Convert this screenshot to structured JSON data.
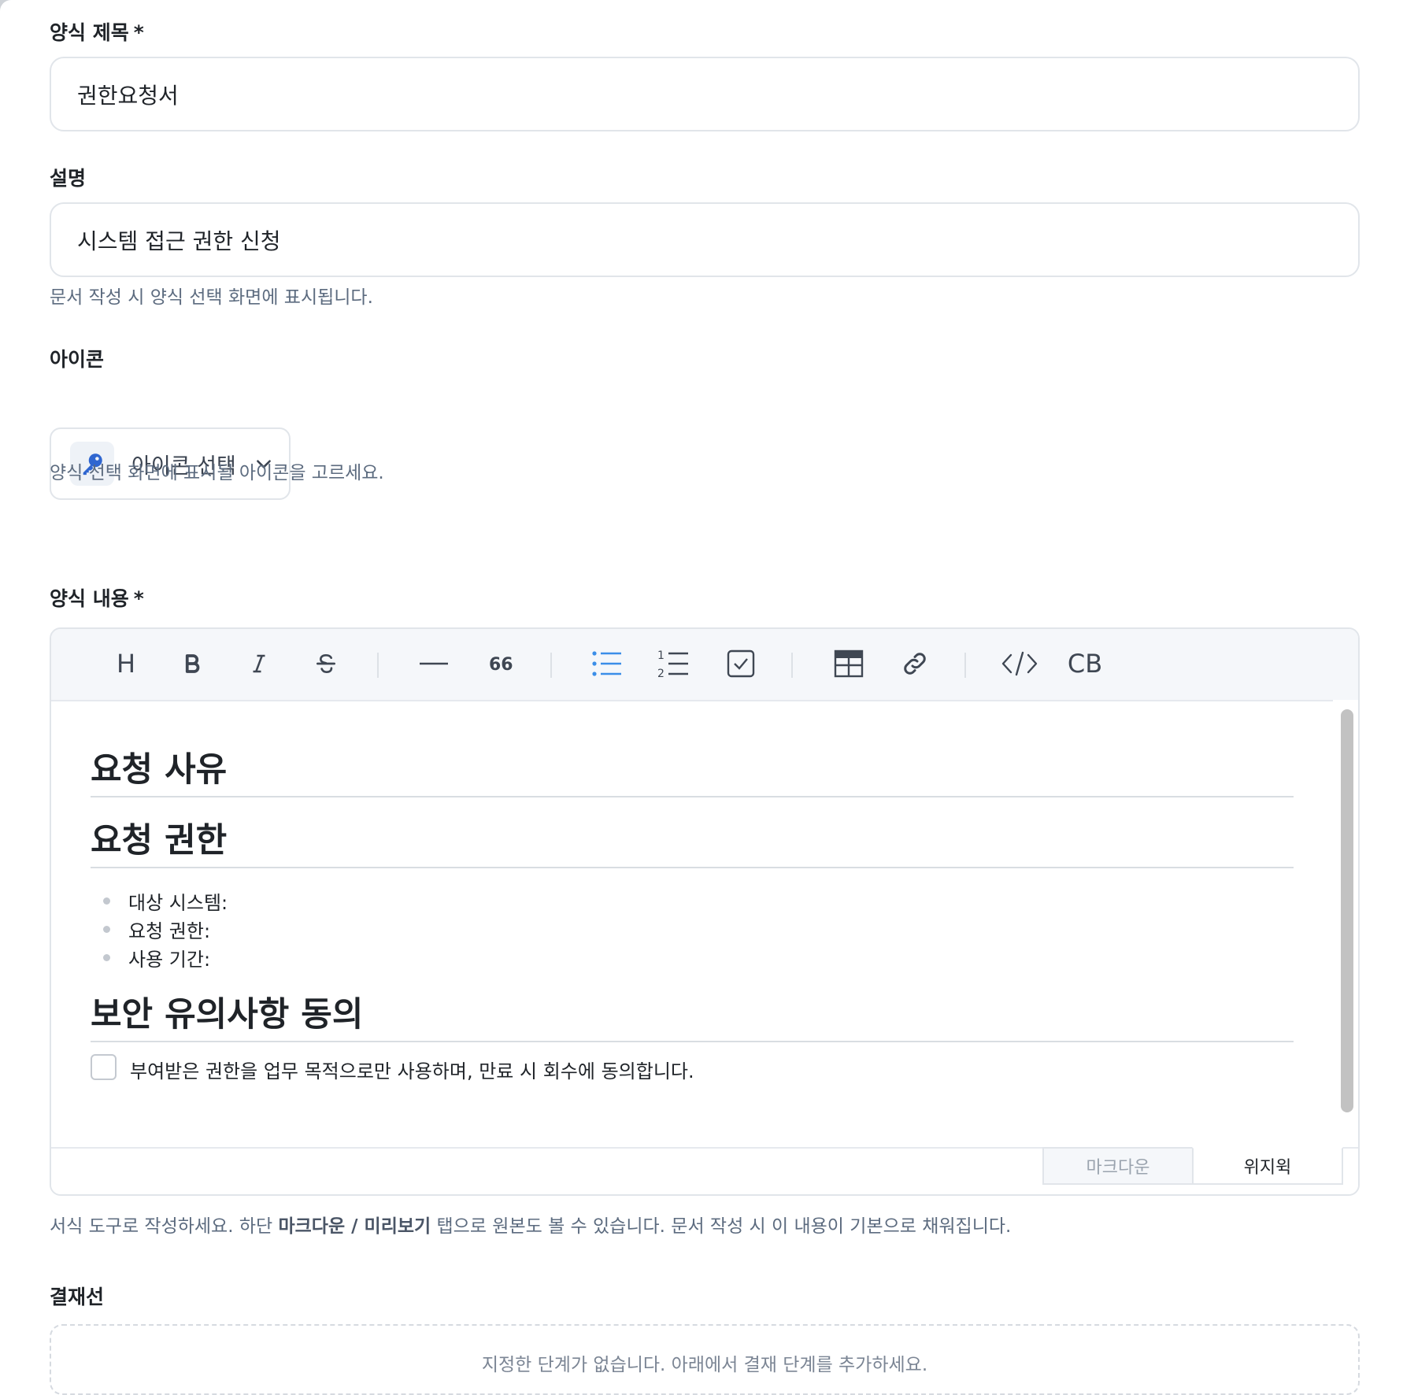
{
  "form": {
    "title_label": "양식 제목",
    "required_mark": "*",
    "title_value": "권한요청서",
    "description_label": "설명",
    "description_value": "시스템 접근 권한 신청",
    "description_help": "문서 작성 시 양식 선택 화면에 표시됩니다.",
    "icon_label": "아이콘",
    "icon_select_label": "아이콘 선택",
    "icon_selected": "key-icon",
    "icon_help": "양식 선택 화면에 표시될 아이콘을 고르세요.",
    "content_label": "양식 내용",
    "content_help_prefix": "서식 도구로 작성하세요. 하단 ",
    "content_help_strong": "마크다운 / 미리보기",
    "content_help_suffix": " 탭으로 원본도 볼 수 있습니다. 문서 작성 시 이 내용이 기본으로 채워집니다.",
    "approval_label": "결재선",
    "approval_empty": "지정한 단계가 없습니다. 아래에서 결재 단계를 추가하세요."
  },
  "toolbar": {
    "heading": "H",
    "code_block": "CB",
    "icons": [
      "heading-icon",
      "bold-icon",
      "italic-icon",
      "strike-icon",
      "hr-icon",
      "quote-icon",
      "bullet-list-icon",
      "ordered-list-icon",
      "task-list-icon",
      "table-icon",
      "link-icon",
      "code-icon",
      "code-block-icon"
    ],
    "active_color": "#3b8ee8"
  },
  "editor": {
    "heading1": "요청 사유",
    "heading2": "요청 권한",
    "bullets": [
      "대상 시스템:",
      "요청 권한:",
      "사용 기간:"
    ],
    "heading3": "보안 유의사항 동의",
    "task": "부여받은 권한을 업무 목적으로만 사용하며, 만료 시 회수에 동의합니다.",
    "task_checked": false
  },
  "tabs": {
    "markdown": "마크다운",
    "wysiwyg": "위지윅",
    "active": "wysiwyg"
  },
  "colors": {
    "key_icon": "#2f66d0",
    "help_text": "#5c6b7f"
  }
}
